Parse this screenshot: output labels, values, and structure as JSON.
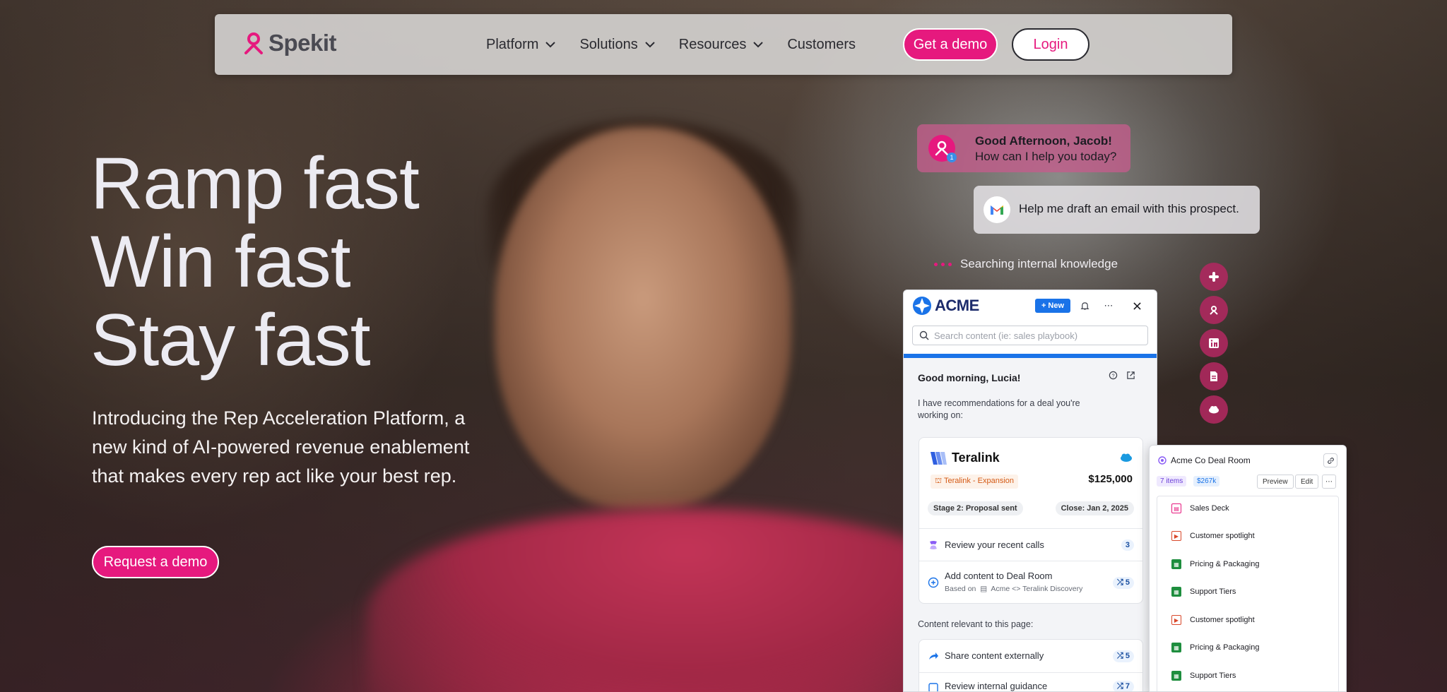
{
  "brand": {
    "name": "Spekit",
    "accent": "#e6197e"
  },
  "nav": {
    "items": [
      {
        "label": "Platform",
        "has_dropdown": true
      },
      {
        "label": "Solutions",
        "has_dropdown": true
      },
      {
        "label": "Resources",
        "has_dropdown": true
      },
      {
        "label": "Customers",
        "has_dropdown": false
      }
    ],
    "demo_label": "Get a demo",
    "login_label": "Login"
  },
  "hero": {
    "headline": [
      "Ramp fast",
      "Win fast",
      "Stay fast"
    ],
    "subtext": "Introducing the Rep Acceleration Platform, a new kind of AI-powered revenue enablement that makes every rep act like your best rep.",
    "cta_label": "Request a demo"
  },
  "chat": {
    "greeting_title": "Good Afternoon, Jacob!",
    "greeting_sub": "How can I help you today?",
    "badge_count": "1",
    "user_request": "Help me draft an email with this prospect.",
    "status": "Searching internal knowledge"
  },
  "integrations": [
    "slack-icon",
    "spekit-icon",
    "linkedin-icon",
    "document-icon",
    "salesforce-icon"
  ],
  "acme": {
    "logo": "ACME",
    "new_label": "New",
    "search_placeholder": "Search content (ie: sales playbook)",
    "greeting": "Good morning, Lucia!",
    "reco_text": "I have recommendations for a deal you're working on:",
    "deal": {
      "name": "Teralink",
      "tag": "Teralink - Expansion",
      "amount": "$125,000",
      "stage": "Stage 2: Proposal sent",
      "close": "Close: Jan 2, 2025"
    },
    "actions": [
      {
        "label": "Review your recent calls",
        "count": "3"
      },
      {
        "label": "Add content to Deal Room",
        "sub": "Based on",
        "sub_ref": "Acme <> Teralink Discovery",
        "count": "5"
      }
    ],
    "content_title": "Content relevant to this page:",
    "content_items": [
      {
        "label": "Share content externally",
        "count": "5"
      },
      {
        "label": "Review internal guidance",
        "count": "7"
      }
    ]
  },
  "deal_room": {
    "title": "Acme Co Deal Room",
    "items_count": "7 items",
    "value": "$267k",
    "preview_label": "Preview",
    "edit_label": "Edit",
    "files": [
      {
        "name": "Sales Deck",
        "kind": "pdf",
        "color": "#e6197e"
      },
      {
        "name": "Customer spotlight",
        "kind": "video",
        "color": "#d9482b"
      },
      {
        "name": "Pricing & Packaging",
        "kind": "sheet",
        "color": "#1e8e3e"
      },
      {
        "name": "Support Tiers",
        "kind": "sheet",
        "color": "#1e8e3e"
      },
      {
        "name": "Customer spotlight",
        "kind": "video",
        "color": "#d9482b"
      },
      {
        "name": "Pricing & Packaging",
        "kind": "sheet",
        "color": "#1e8e3e"
      },
      {
        "name": "Support Tiers",
        "kind": "sheet",
        "color": "#1e8e3e"
      }
    ]
  }
}
